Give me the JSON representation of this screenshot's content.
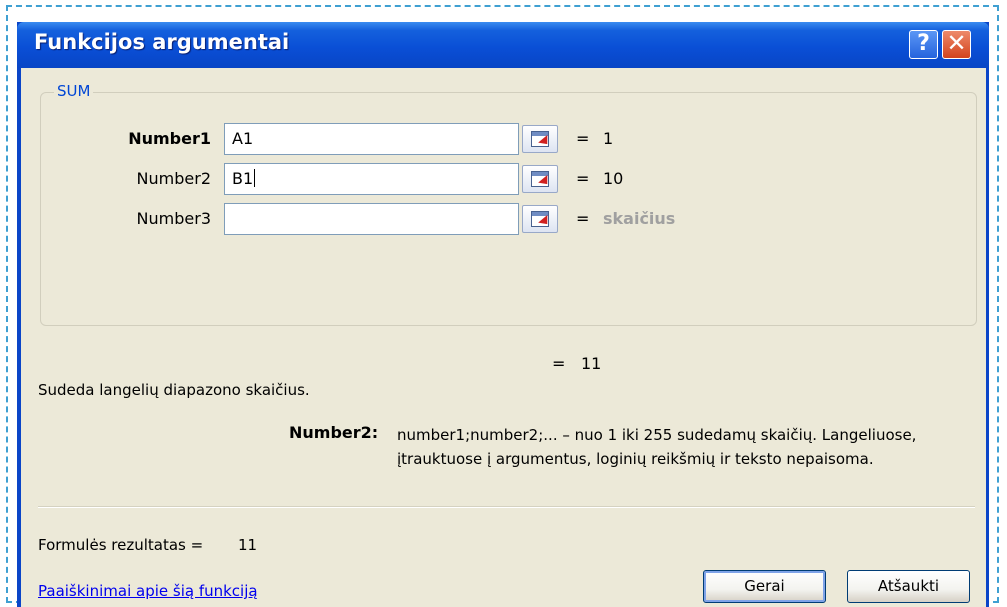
{
  "window": {
    "title": "Funkcijos argumentai",
    "help_glyph": "?",
    "close_glyph": "✕"
  },
  "group": {
    "label": "SUM"
  },
  "arguments": [
    {
      "label": "Number1",
      "value": "A1",
      "equals": "=",
      "result": "1"
    },
    {
      "label": "Number2",
      "value": "B1",
      "equals": "=",
      "result": "10"
    },
    {
      "label": "Number3",
      "value": "",
      "equals": "=",
      "result": "skaičius"
    }
  ],
  "result": {
    "equals": "=",
    "value": "11"
  },
  "function_description": "Sudeda langelių diapazono skaičius.",
  "argument_description": {
    "name": "Number2:",
    "text": "number1;number2;... – nuo 1 iki 255 sudedamų skaičių. Langeliuose, įtrauktuose į argumentus, loginių reikšmių ir teksto nepaisoma."
  },
  "formula_result": {
    "label": "Formulės rezultatas =",
    "value": "11"
  },
  "help_link": "Paaiškinimai apie šią funkciją",
  "buttons": {
    "ok": "Gerai",
    "cancel": "Atšaukti"
  },
  "colors": {
    "titlebar": "#0a4fd6",
    "dialog_background": "#ece9d8",
    "group_label": "#0046d5",
    "link": "#0000ee",
    "hint_text": "#a0a0a0",
    "frame_dash": "#3fa0d2"
  },
  "icons": {
    "help": "help-icon",
    "close": "close-icon",
    "collapse_dialog": "collapse-dialog-icon"
  }
}
